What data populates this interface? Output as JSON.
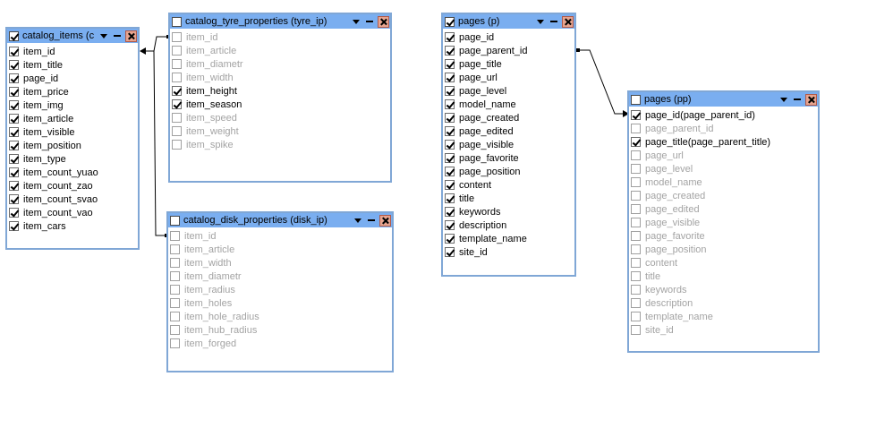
{
  "tables": {
    "catalog_items": {
      "title": "catalog_items (c",
      "checked": true,
      "fields": [
        {
          "label": "item_id",
          "checked": true
        },
        {
          "label": "item_title",
          "checked": true
        },
        {
          "label": "page_id",
          "checked": true
        },
        {
          "label": "item_price",
          "checked": true
        },
        {
          "label": "item_img",
          "checked": true
        },
        {
          "label": "item_article",
          "checked": true
        },
        {
          "label": "item_visible",
          "checked": true
        },
        {
          "label": "item_position",
          "checked": true
        },
        {
          "label": "item_type",
          "checked": true
        },
        {
          "label": "item_count_yuao",
          "checked": true
        },
        {
          "label": "item_count_zao",
          "checked": true
        },
        {
          "label": "item_count_svao",
          "checked": true
        },
        {
          "label": "item_count_vao",
          "checked": true
        },
        {
          "label": "item_cars",
          "checked": true
        }
      ]
    },
    "tyre": {
      "title": "catalog_tyre_properties (tyre_ip)",
      "checked": false,
      "fields": [
        {
          "label": "item_id",
          "checked": false
        },
        {
          "label": "item_article",
          "checked": false
        },
        {
          "label": "item_diametr",
          "checked": false
        },
        {
          "label": "item_width",
          "checked": false
        },
        {
          "label": "item_height",
          "checked": true
        },
        {
          "label": "item_season",
          "checked": true
        },
        {
          "label": "item_speed",
          "checked": false
        },
        {
          "label": "item_weight",
          "checked": false
        },
        {
          "label": "item_spike",
          "checked": false
        }
      ]
    },
    "disk": {
      "title": "catalog_disk_properties (disk_ip)",
      "checked": false,
      "fields": [
        {
          "label": "item_id",
          "checked": false
        },
        {
          "label": "item_article",
          "checked": false
        },
        {
          "label": "item_width",
          "checked": false
        },
        {
          "label": "item_diametr",
          "checked": false
        },
        {
          "label": "item_radius",
          "checked": false
        },
        {
          "label": "item_holes",
          "checked": false
        },
        {
          "label": "item_hole_radius",
          "checked": false
        },
        {
          "label": "item_hub_radius",
          "checked": false
        },
        {
          "label": "item_forged",
          "checked": false
        }
      ]
    },
    "pages_p": {
      "title": "pages (p)",
      "checked": true,
      "fields": [
        {
          "label": "page_id",
          "checked": true
        },
        {
          "label": "page_parent_id",
          "checked": true
        },
        {
          "label": "page_title",
          "checked": true
        },
        {
          "label": "page_url",
          "checked": true
        },
        {
          "label": "page_level",
          "checked": true
        },
        {
          "label": "model_name",
          "checked": true
        },
        {
          "label": "page_created",
          "checked": true
        },
        {
          "label": "page_edited",
          "checked": true
        },
        {
          "label": "page_visible",
          "checked": true
        },
        {
          "label": "page_favorite",
          "checked": true
        },
        {
          "label": "page_position",
          "checked": true
        },
        {
          "label": "content",
          "checked": true
        },
        {
          "label": "title",
          "checked": true
        },
        {
          "label": "keywords",
          "checked": true
        },
        {
          "label": "description",
          "checked": true
        },
        {
          "label": "template_name",
          "checked": true
        },
        {
          "label": "site_id",
          "checked": true
        }
      ]
    },
    "pages_pp": {
      "title": "pages (pp)",
      "checked": false,
      "fields": [
        {
          "label": "page_id(page_parent_id)",
          "checked": true
        },
        {
          "label": "page_parent_id",
          "checked": false
        },
        {
          "label": "page_title(page_parent_title)",
          "checked": true
        },
        {
          "label": "page_url",
          "checked": false
        },
        {
          "label": "page_level",
          "checked": false
        },
        {
          "label": "model_name",
          "checked": false
        },
        {
          "label": "page_created",
          "checked": false
        },
        {
          "label": "page_edited",
          "checked": false
        },
        {
          "label": "page_visible",
          "checked": false
        },
        {
          "label": "page_favorite",
          "checked": false
        },
        {
          "label": "page_position",
          "checked": false
        },
        {
          "label": "content",
          "checked": false
        },
        {
          "label": "title",
          "checked": false
        },
        {
          "label": "keywords",
          "checked": false
        },
        {
          "label": "description",
          "checked": false
        },
        {
          "label": "template_name",
          "checked": false
        },
        {
          "label": "site_id",
          "checked": false
        }
      ]
    }
  },
  "colors": {
    "header": "#7aaef0",
    "border": "#80a7d6",
    "disabled_text": "#a3a3a3"
  },
  "icons": [
    "checkbox-icon",
    "dropdown-caret-icon",
    "minimize-icon",
    "close-icon"
  ]
}
